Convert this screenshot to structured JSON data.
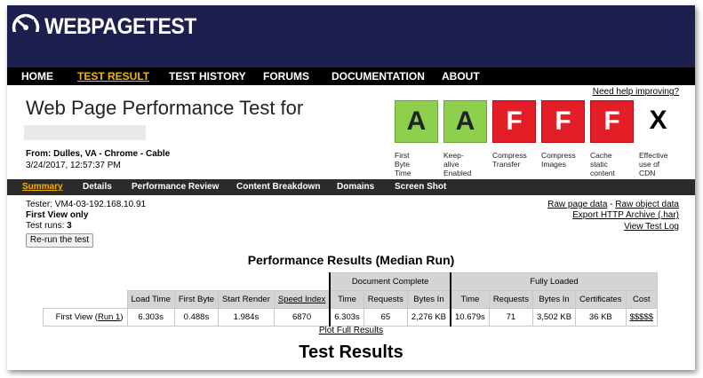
{
  "header": {
    "logo_text": "WEBPAGETEST",
    "logo_icon": "speedometer-icon"
  },
  "nav": {
    "items": [
      {
        "label": "HOME",
        "active": false
      },
      {
        "label": "TEST RESULT",
        "active": true
      },
      {
        "label": "TEST HISTORY",
        "active": false
      },
      {
        "label": "FORUMS",
        "active": false
      },
      {
        "label": "DOCUMENTATION",
        "active": false
      },
      {
        "label": "ABOUT",
        "active": false
      }
    ]
  },
  "help_link": "Need help improving?",
  "page_title": "Web Page Performance Test for",
  "from": "From: Dulles, VA - Chrome - Cable",
  "date": "3/24/2017, 12:57:37 PM",
  "grades": [
    {
      "grade": "A",
      "label_lines": [
        "First Byte",
        "Time"
      ],
      "status": "good"
    },
    {
      "grade": "A",
      "label_lines": [
        "Keep-alive",
        "Enabled"
      ],
      "status": "good"
    },
    {
      "grade": "F",
      "label_lines": [
        "Compress",
        "Transfer"
      ],
      "status": "bad"
    },
    {
      "grade": "F",
      "label_lines": [
        "Compress",
        "Images"
      ],
      "status": "bad"
    },
    {
      "grade": "F",
      "label_lines": [
        "Cache",
        "static",
        "content"
      ],
      "status": "bad"
    },
    {
      "grade": "X",
      "label_lines": [
        "Effective",
        "use of CDN"
      ],
      "status": "none"
    }
  ],
  "colors": {
    "good": "#8ed04e",
    "bad": "#e41e26",
    "nav_bg": "#1d1f4e",
    "active": "#f5b400"
  },
  "subnav": {
    "items": [
      {
        "label": "Summary",
        "active": true
      },
      {
        "label": "Details",
        "active": false
      },
      {
        "label": "Performance Review",
        "active": false
      },
      {
        "label": "Content Breakdown",
        "active": false
      },
      {
        "label": "Domains",
        "active": false
      },
      {
        "label": "Screen Shot",
        "active": false
      }
    ]
  },
  "tester": "Tester: VM4-03-192.168.10.91",
  "first_view_only": "First View only",
  "test_runs_label": "Test runs: ",
  "test_runs_value": "3",
  "rerun_button": "Re-run the test",
  "links": {
    "raw_page_data": "Raw page data",
    "separator": " - ",
    "raw_object_data": "Raw object data",
    "export_har": "Export HTTP Archive (.har)",
    "view_test_log": "View Test Log"
  },
  "perf_title": "Performance Results (Median Run)",
  "table": {
    "group_document_complete": "Document Complete",
    "group_fully_loaded": "Fully Loaded",
    "columns": [
      "Load Time",
      "First Byte",
      "Start Render",
      "Speed Index",
      "Time",
      "Requests",
      "Bytes In",
      "Time",
      "Requests",
      "Bytes In",
      "Certificates",
      "Cost"
    ],
    "row_label": "First View (",
    "row_link": "Run 1",
    "row_label_end": ")",
    "values": [
      "6.303s",
      "0.488s",
      "1.984s",
      "6870",
      "6.303s",
      "65",
      "2,276 KB",
      "10.679s",
      "71",
      "3,502 KB",
      "36 KB",
      "$$$$$"
    ]
  },
  "plot_link": "Plot Full Results",
  "test_results_heading": "Test Results"
}
